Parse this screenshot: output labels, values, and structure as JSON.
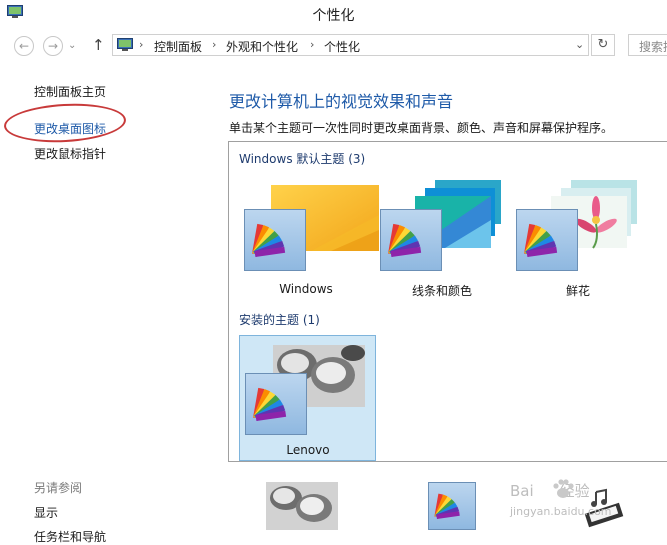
{
  "window": {
    "title": "个性化"
  },
  "nav": {
    "back": "←",
    "forward": "→",
    "up": "↑",
    "breadcrumbs": [
      "控制面板",
      "外观和个性化",
      "个性化"
    ],
    "separator": "›",
    "dropdown": "⌄",
    "refresh": "↻",
    "search_placeholder": "搜索控制面板"
  },
  "sidebar": {
    "home": "控制面板主页",
    "links": [
      "更改桌面图标",
      "更改鼠标指针"
    ],
    "see_also_heading": "另请参阅",
    "see_also": [
      "显示",
      "任务栏和导航"
    ]
  },
  "main": {
    "title": "更改计算机上的视觉效果和声音",
    "description": "单击某个主题可一次性同时更改桌面背景、颜色、声音和屏幕保护程序。",
    "groups": [
      {
        "title": "Windows 默认主题 (3)",
        "themes": [
          "Windows",
          "线条和颜色",
          "鲜花"
        ]
      },
      {
        "title": "安装的主题 (1)",
        "themes": [
          "Lenovo"
        ]
      }
    ]
  },
  "watermark": {
    "brand": "Bai",
    "brand2": "经验",
    "url": "jingyan.baidu.com"
  },
  "colors": {
    "accent": "#1e5aa8",
    "highlight": "#cfe7f6",
    "annotation": "#c83a3a"
  }
}
